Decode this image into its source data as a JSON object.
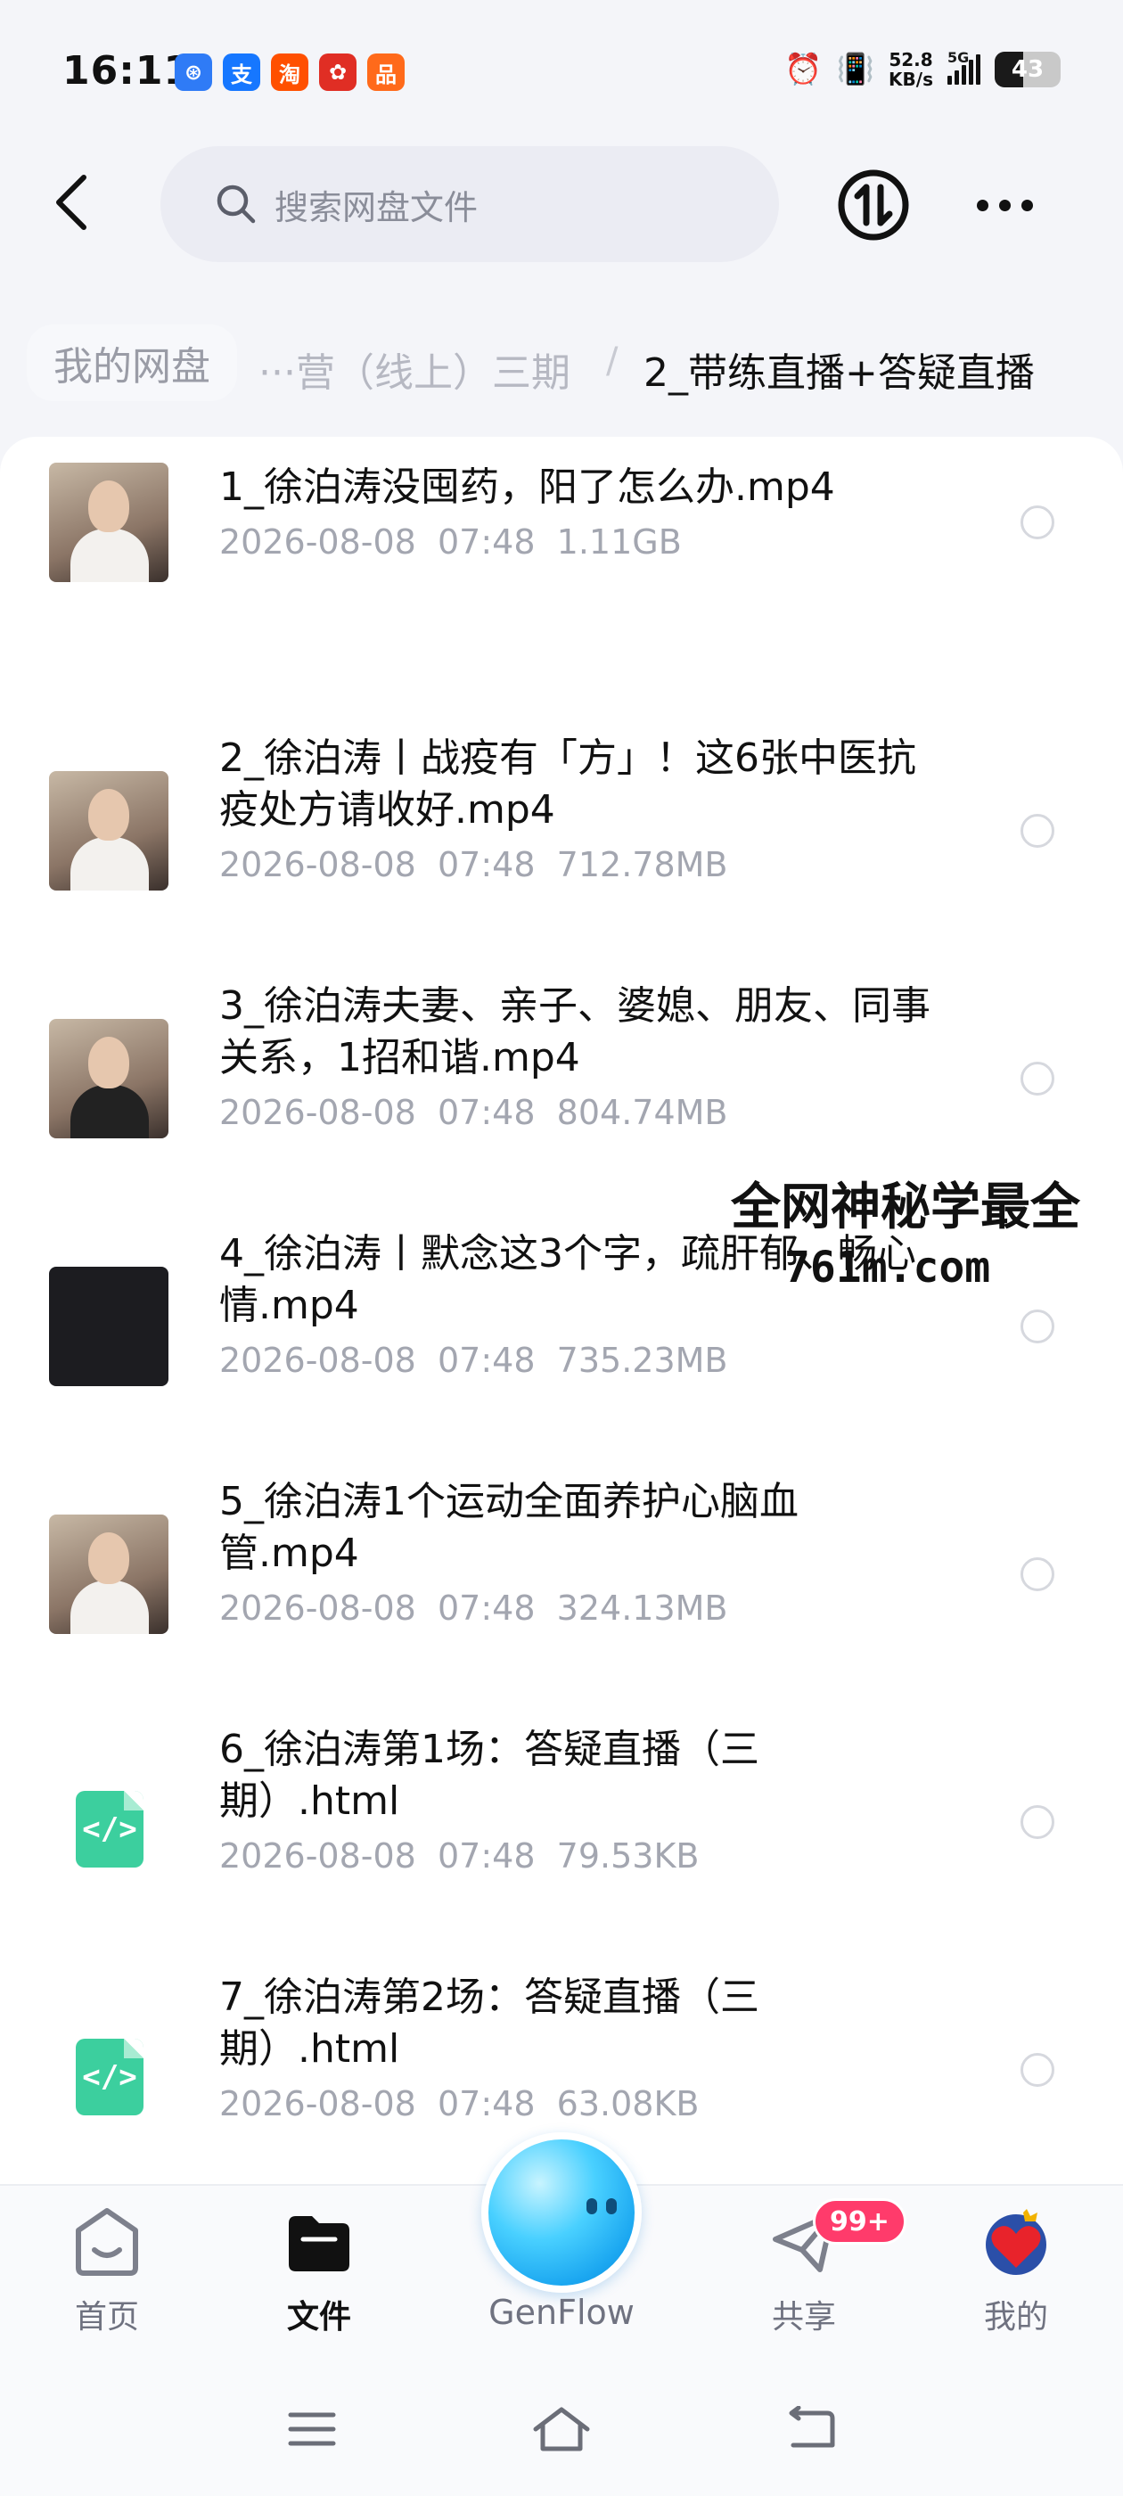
{
  "status_bar": {
    "time": "16:11",
    "apps": [
      {
        "name": "sim-app-icon",
        "glyph": "⊛",
        "color": "#2f7bf6"
      },
      {
        "name": "alipay-icon",
        "glyph": "支",
        "color": "#1677ff"
      },
      {
        "name": "taobao-icon",
        "glyph": "淘",
        "color": "#ff5000"
      },
      {
        "name": "pinduoduo-icon",
        "glyph": "✿",
        "color": "#e02e24"
      },
      {
        "name": "app-icon-orange",
        "glyph": "品",
        "color": "#ff6a1a"
      }
    ],
    "net_speed_value": "52.8",
    "net_speed_unit": "KB/s",
    "network_type": "5G",
    "battery_percent": "43",
    "battery_level": 0.43
  },
  "top_bar": {
    "search_placeholder": "搜索网盘文件"
  },
  "breadcrumb": {
    "root": "我的网盘",
    "middle": "···营（线上）三期",
    "separator": "/",
    "current": "2_带练直播+答疑直播"
  },
  "files": [
    {
      "name": "1_徐泊涛没囤药，阳了怎么办.mp4",
      "meta": "2026-08-08  07:48  1.11GB",
      "thumb": "video"
    },
    {
      "name": "2_徐泊涛丨战疫有「方」！这6张中医抗疫处方请收好.mp4",
      "meta": "2026-08-08  07:48  712.78MB",
      "thumb": "video"
    },
    {
      "name": "3_徐泊涛夫妻、亲子、婆媳、朋友、同事关系，1招和谐.mp4",
      "meta": "2026-08-08  07:48  804.74MB",
      "thumb": "video"
    },
    {
      "name": "4_徐泊涛丨默念这3个字，疏肝郁、畅心情.mp4",
      "meta": "2026-08-08  07:48  735.23MB",
      "thumb": "black"
    },
    {
      "name": "5_徐泊涛1个运动全面养护心脑血管.mp4",
      "meta": "2026-08-08  07:48  324.13MB",
      "thumb": "video"
    },
    {
      "name": "6_徐泊涛第1场：答疑直播（三期）.html",
      "meta": "2026-08-08  07:48  79.53KB",
      "thumb": "html"
    },
    {
      "name": "7_徐泊涛第2场：答疑直播（三期）.html",
      "meta": "2026-08-08  07:48  63.08KB",
      "thumb": "html"
    }
  ],
  "watermark": {
    "line1": "全网神秘学最全",
    "line2": "761m.com"
  },
  "bottom_nav": {
    "home": "首页",
    "files": "文件",
    "genflow": "GenFlow",
    "share": "共享",
    "share_badge": "99+",
    "mine": "我的"
  },
  "colors": {
    "accent_green": "#3ccf9e",
    "badge_red": "#ff3b6b",
    "orb_blue": "#1aa6f0"
  }
}
